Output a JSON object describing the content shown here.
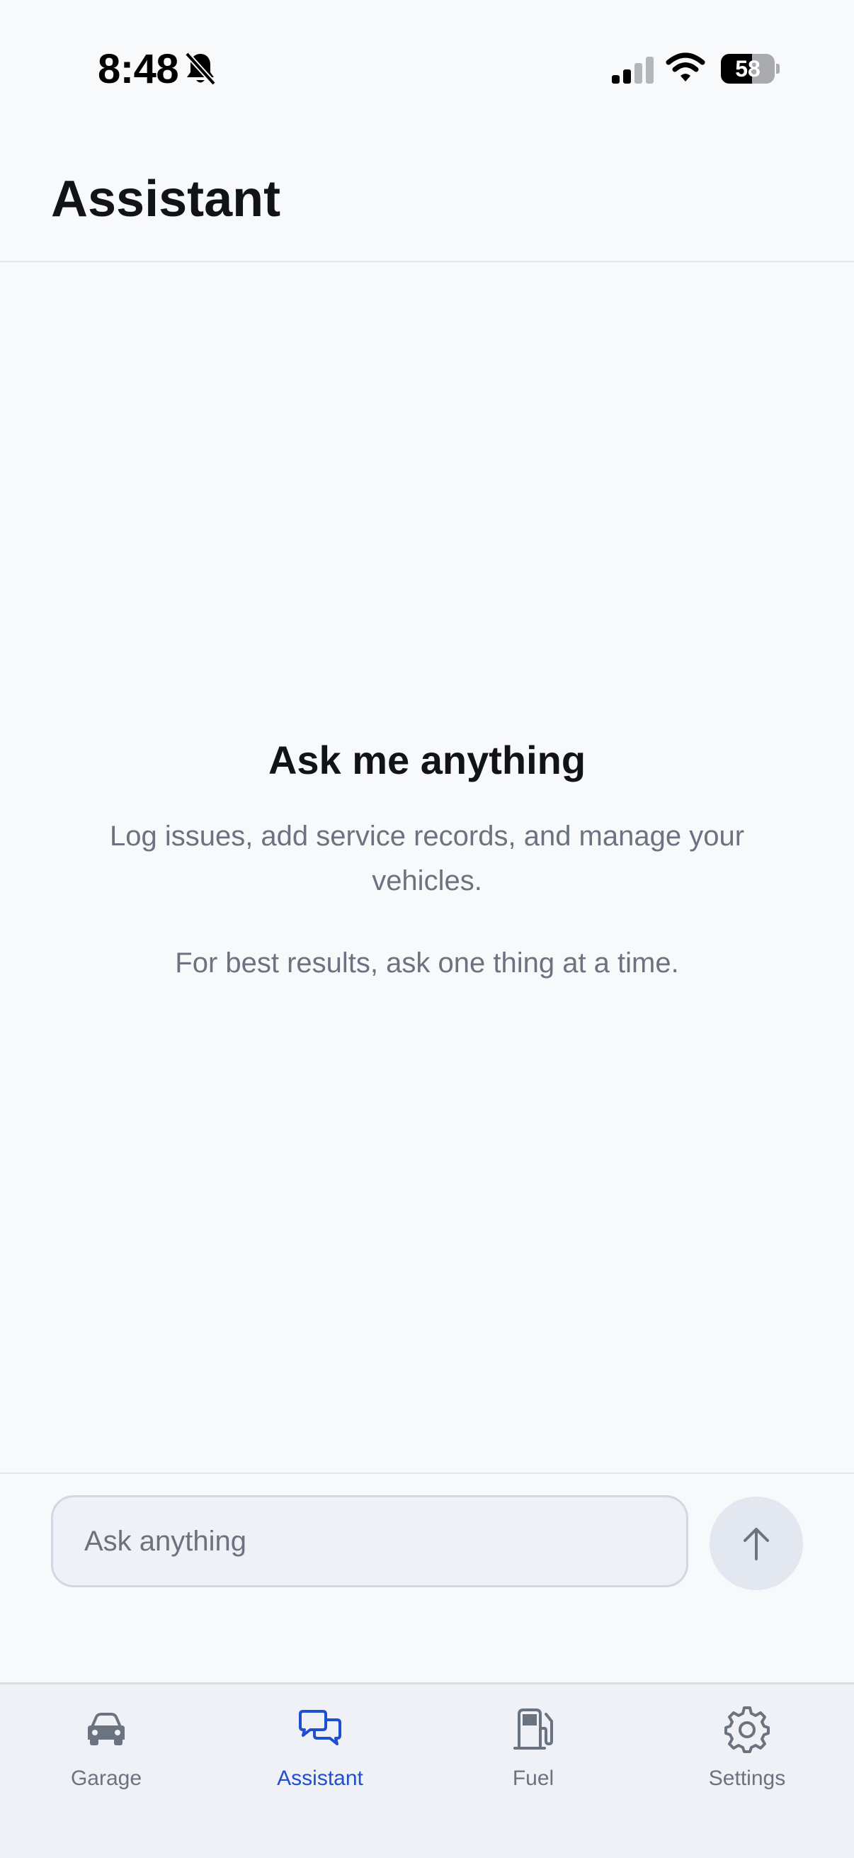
{
  "status_bar": {
    "time": "8:48",
    "battery_percent": "58",
    "battery_level": 0.58,
    "icons": [
      "bell-slash-icon",
      "signal-icon",
      "wifi-icon",
      "battery-icon"
    ]
  },
  "header": {
    "title": "Assistant"
  },
  "empty_state": {
    "title": "Ask me anything",
    "description": "Log issues, add service records, and manage your vehicles.",
    "hint": "For best results, ask one thing at a time."
  },
  "composer": {
    "placeholder": "Ask anything",
    "value": "",
    "send_icon": "arrow-up-icon"
  },
  "tab_bar": {
    "tabs": [
      {
        "label": "Garage",
        "icon": "car-icon",
        "active": false
      },
      {
        "label": "Assistant",
        "icon": "chat-bubbles-icon",
        "active": true
      },
      {
        "label": "Fuel",
        "icon": "fuel-pump-icon",
        "active": false
      },
      {
        "label": "Settings",
        "icon": "gear-icon",
        "active": false
      }
    ]
  },
  "colors": {
    "background": "#f8f9fb",
    "accent": "#1f4fd1",
    "muted_text": "#6b7280",
    "tab_bar_background": "#eff1f6"
  }
}
